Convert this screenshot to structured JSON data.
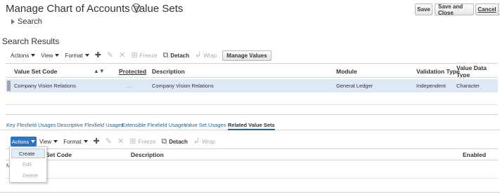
{
  "header": {
    "title": "Manage Chart of Accounts Value Sets",
    "help_icon": "?",
    "buttons": {
      "save": "Save",
      "save_close": "Save and Close",
      "cancel": "Cancel"
    }
  },
  "search": {
    "label": "Search"
  },
  "results": {
    "title": "Search Results",
    "toolbar": {
      "actions": "Actions",
      "view": "View",
      "format": "Format",
      "freeze": "Freeze",
      "detach": "Detach",
      "wrap": "Wrap",
      "manage_values": "Manage Values"
    },
    "columns": [
      "Value Set Code",
      "Protected",
      "Description",
      "Module",
      "Validation Type",
      "Value Data Type"
    ],
    "rows": [
      {
        "code": "Company Vision Relations",
        "protected": "...",
        "description": "Company Vision Relations",
        "module": "General Ledger",
        "validation": "Independent",
        "data_type": "Character"
      }
    ]
  },
  "tabs": [
    {
      "label": "Key Flexfield Usages",
      "active": false
    },
    {
      "label": "Descriptive Flexfield Usages",
      "active": false
    },
    {
      "label": "Extensible Flexfield Usages",
      "active": false
    },
    {
      "label": "Value Set Usages",
      "active": false
    },
    {
      "label": "Related Value Sets",
      "active": true
    }
  ],
  "related": {
    "toolbar": {
      "actions": "Actions",
      "view": "View",
      "format": "Format",
      "freeze": "Freeze",
      "detach": "Detach",
      "wrap": "Wrap"
    },
    "columns": {
      "code": "e Set Code",
      "description": "Description",
      "enabled": "Enabled"
    },
    "no_data": "N",
    "menu": [
      "Create",
      "Edit",
      "Delete"
    ]
  },
  "colors": {
    "accent": "#2b75c6",
    "selected_row": "#dde9f7",
    "link": "#2a6496"
  }
}
